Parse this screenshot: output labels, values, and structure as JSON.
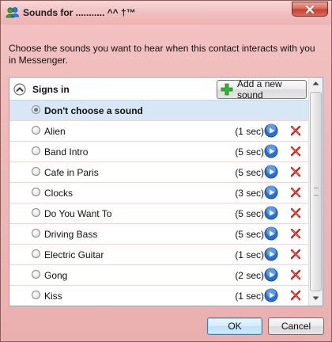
{
  "window": {
    "title": "Sounds for  ........... ^^  †™"
  },
  "instruction": "Choose the sounds you want to hear when this contact interacts with you in Messenger.",
  "section": {
    "label": "Signs in",
    "add_button_label": "Add a new sound"
  },
  "sounds": [
    {
      "name": "Don't choose a sound",
      "duration": "",
      "selected": true
    },
    {
      "name": "Alien",
      "duration": "(1 sec)",
      "selected": false
    },
    {
      "name": "Band Intro",
      "duration": "(5 sec)",
      "selected": false
    },
    {
      "name": "Cafe in Paris",
      "duration": "(5 sec)",
      "selected": false
    },
    {
      "name": "Clocks",
      "duration": "(3 sec)",
      "selected": false
    },
    {
      "name": "Do You Want To",
      "duration": "(5 sec)",
      "selected": false
    },
    {
      "name": "Driving Bass",
      "duration": "(5 sec)",
      "selected": false
    },
    {
      "name": "Electric Guitar",
      "duration": "(1 sec)",
      "selected": false
    },
    {
      "name": "Gong",
      "duration": "(2 sec)",
      "selected": false
    },
    {
      "name": "Kiss",
      "duration": "(1 sec)",
      "selected": false
    }
  ],
  "buttons": {
    "ok_label": "OK",
    "cancel_label": "Cancel"
  },
  "icons": {
    "title": "messenger-buddies-icon",
    "close": "close-icon",
    "collapse": "chevron-up-icon",
    "add": "plus-icon",
    "play": "play-icon",
    "delete": "delete-x-icon"
  },
  "colors": {
    "window_background": "#efb9b9",
    "selected_row": "#d8e7f6",
    "play_blue": "#2a6fd0",
    "delete_red": "#c8281e",
    "add_green": "#2fb12f"
  }
}
